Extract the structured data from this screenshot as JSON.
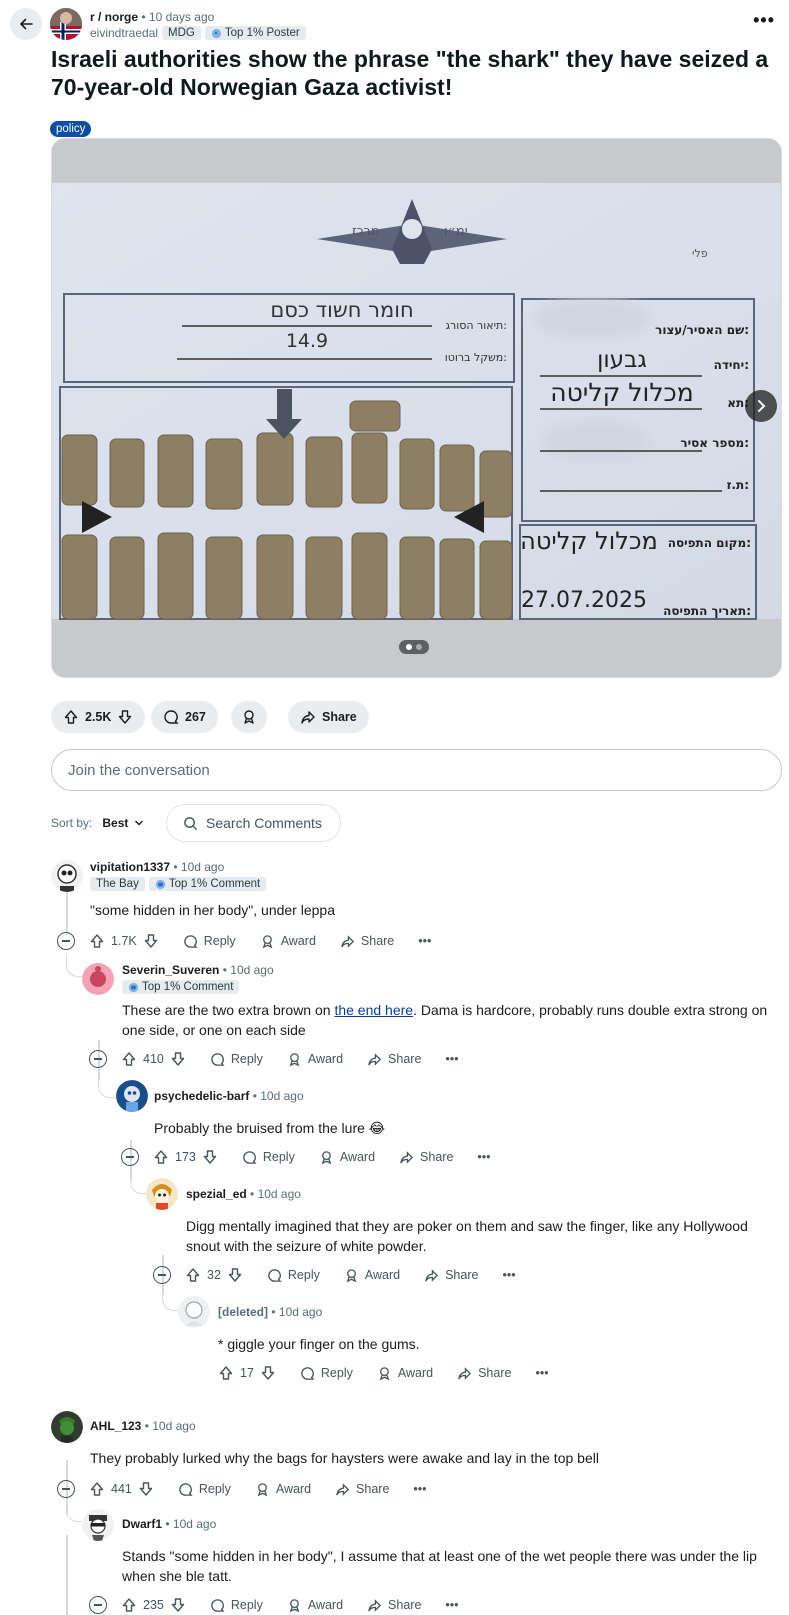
{
  "post": {
    "subreddit": "r / norge",
    "time": "10 days ago",
    "author": "eivindtraedal",
    "author_flair": "MDG",
    "author_badge": "Top 1% Poster",
    "title": "Israeli authorities show the phrase \"the shark\" they have seized a 70-year-old Norwegian Gaza activist!",
    "post_flair": "policy",
    "image_text": {
      "header_left": "מרכז",
      "header_right": "ימ״ן",
      "corner": "פלי",
      "substance_label": "תיאור הסורג:",
      "substance": "חומר חשוד כסם",
      "weight_label": "משקל ברוטו:",
      "weight": "14.9",
      "prisoner_label": "שם האסיר/עצור:",
      "unit_label": "יחידה:",
      "unit": "גבעון",
      "date_label": "תא:",
      "facility": "מכלול קליטה",
      "id_label": "מספר אסיר:",
      "tz_label": "ת.ז:",
      "place_label": "מקום התפיסה:",
      "place": "מכלול קליטה",
      "seized_date_label": "תאריך התפיסה:",
      "seized_date": "27.07.2025"
    }
  },
  "actions": {
    "votes": "2.5K",
    "comments": "267",
    "share": "Share"
  },
  "join_placeholder": "Join the conversation",
  "sort": {
    "label": "Sort by:",
    "value": "Best",
    "search_placeholder": "Search Comments"
  },
  "comment_actions": {
    "reply": "Reply",
    "award": "Award",
    "share": "Share"
  },
  "comments": [
    {
      "user": "vipitation1337",
      "time": "10d ago",
      "flair": "The Bay",
      "badge": "Top 1% Comment",
      "body": "\"some hidden in her body\", under leppa",
      "votes": "1.7K"
    },
    {
      "user": "Severin_Suveren",
      "time": "10d ago",
      "badge": "Top 1% Comment",
      "body_before": "These are the two extra brown on ",
      "body_link": "the end here",
      "body_after": ". Dama is hardcore, probably runs double extra strong on one side, or one on each side",
      "votes": "410"
    },
    {
      "user": "psychedelic-barf",
      "time": "10d ago",
      "body": "Probably the bruised from the lure 😂",
      "votes": "173"
    },
    {
      "user": "spezial_ed",
      "time": "10d ago",
      "body": "Digg mentally imagined that they are poker on them and saw the finger, like any Hollywood snout with the seizure of white powder.",
      "votes": "32"
    },
    {
      "user": "[deleted]",
      "time": "10d ago",
      "body": "* giggle your finger on the gums.",
      "votes": "17"
    },
    {
      "user": "AHL_123",
      "time": "10d ago",
      "body": "They probably lurked why the bags for haysters were awake and lay in the top bell",
      "votes": "441"
    },
    {
      "user": "Dwarf1",
      "time": "10d ago",
      "body": "Stands \"some hidden in her body\", I assume that at least one of the wet people there was under the lip when she ble tatt.",
      "votes": "235"
    }
  ]
}
